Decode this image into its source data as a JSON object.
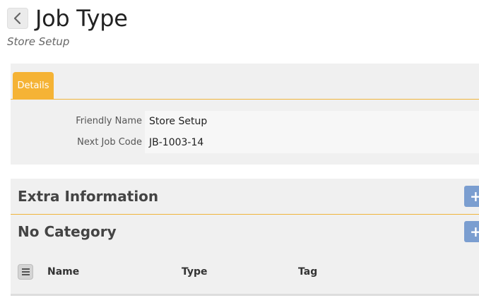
{
  "header": {
    "title": "Job Type",
    "subtitle": "Store Setup",
    "back_icon": "chevron-left-icon"
  },
  "details": {
    "tabs": [
      {
        "label": "Details",
        "active": true
      }
    ],
    "fields": [
      {
        "label": "Friendly Name",
        "value": "Store Setup"
      },
      {
        "label": "Next Job Code",
        "value": "JB-1003-14"
      }
    ]
  },
  "extra_information": {
    "title": "Extra Information",
    "add_icon": "plus-icon"
  },
  "category": {
    "title": "No Category",
    "add_icon": "plus-icon",
    "menu_icon": "hamburger-menu-icon",
    "columns": [
      "Name",
      "Type",
      "Tag"
    ]
  },
  "colors": {
    "accent": "#f5b335",
    "add_button": "#7b9ed0",
    "panel_background": "#f0f0f0"
  }
}
